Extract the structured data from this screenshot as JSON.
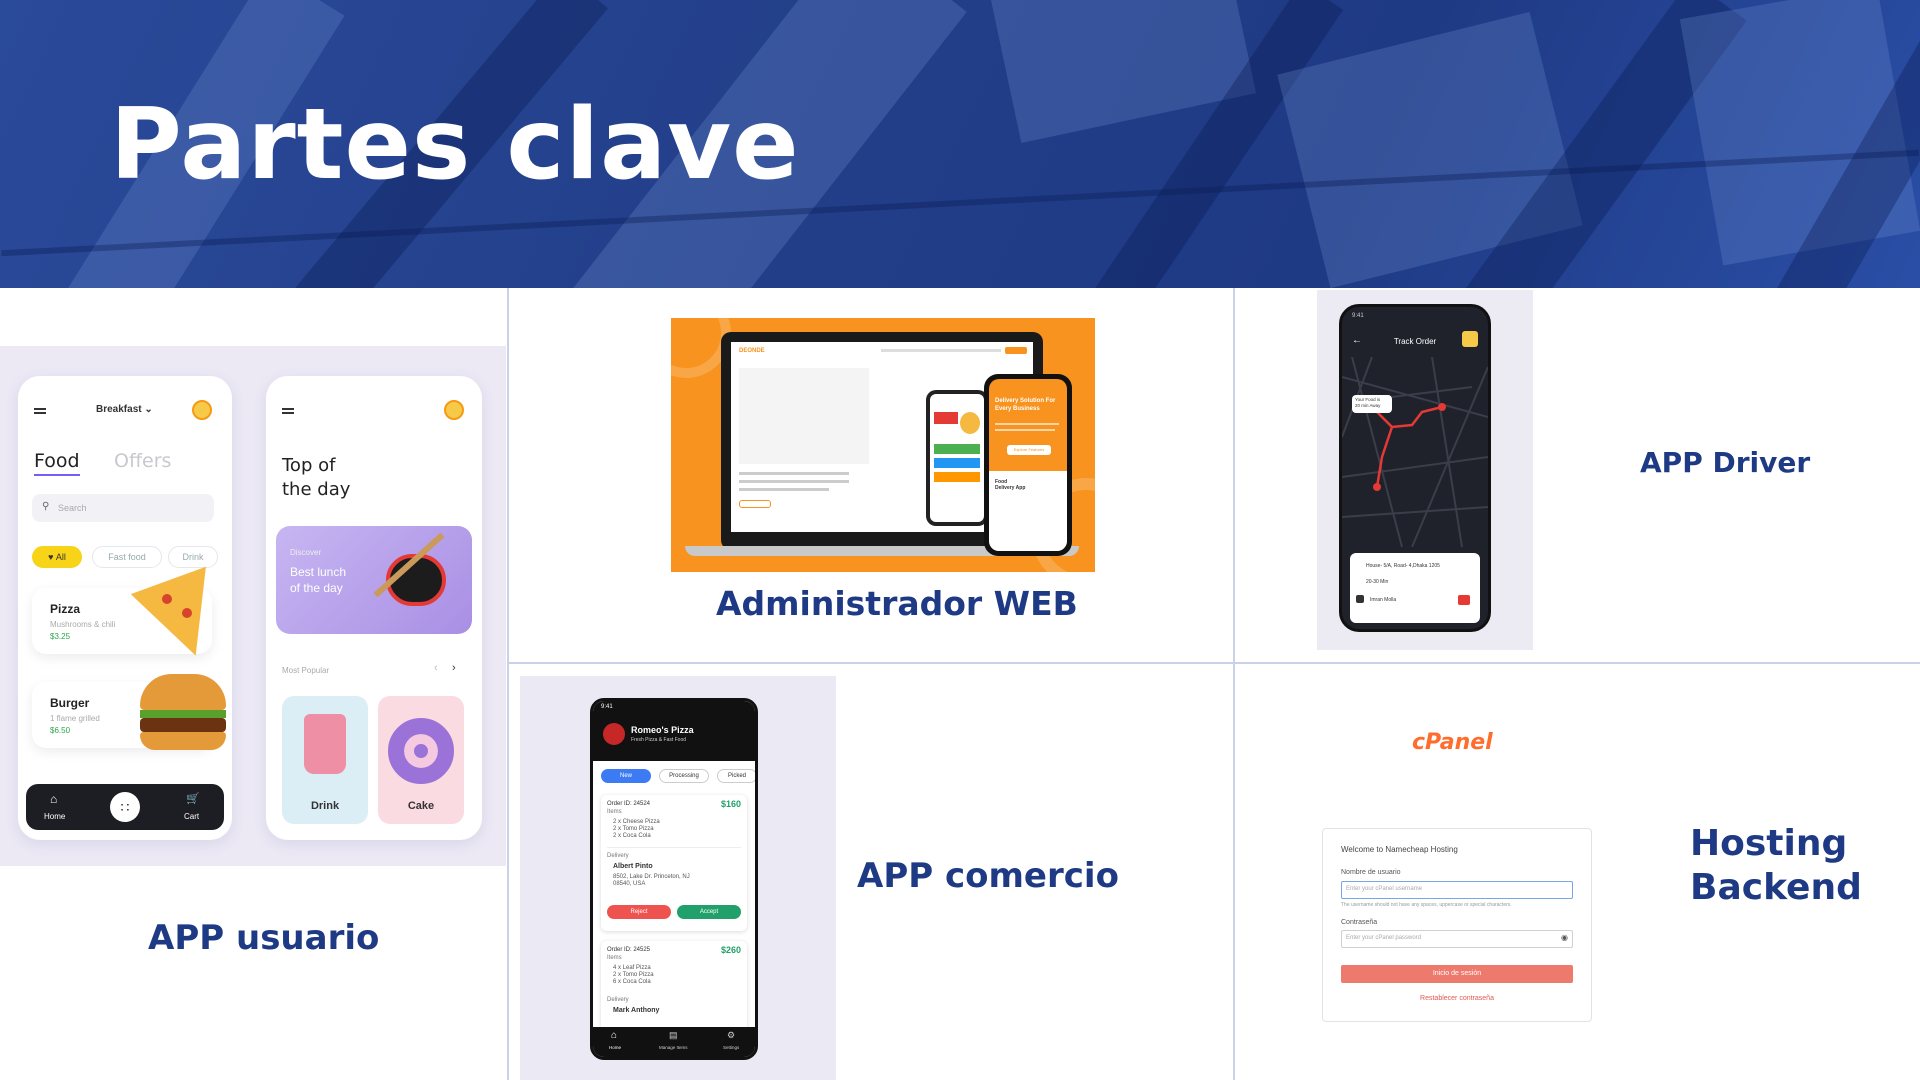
{
  "header": {
    "title": "Partes clave"
  },
  "sections": {
    "app_usuario": {
      "label": "APP usuario"
    },
    "admin_web": {
      "label": "Administrador WEB"
    },
    "app_driver": {
      "label": "APP Driver"
    },
    "app_comercio": {
      "label": "APP comercio"
    },
    "hosting": {
      "label_line1": "Hosting",
      "label_line2": "Backend"
    }
  },
  "user_app": {
    "category": "Breakfast",
    "tab_food": "Food",
    "tab_offers": "Offers",
    "search_placeholder": "Search",
    "chip_all": "All",
    "chip_fast": "Fast food",
    "chip_drink": "Drink",
    "items": [
      {
        "name": "Pizza",
        "desc": "Mushrooms & chili",
        "price": "$3.25"
      },
      {
        "name": "Burger",
        "desc": "1 flame grilled",
        "price": "$6.50"
      }
    ],
    "nav_home": "Home",
    "nav_cart": "Cart",
    "top_title_1": "Top of",
    "top_title_2": "the day",
    "promo_discover": "Discover",
    "promo_line1": "Best lunch",
    "promo_line2": "of the day",
    "most_popular": "Most Popular",
    "popular": [
      "Drink",
      "Cake"
    ]
  },
  "driver_app": {
    "time": "9:41",
    "title": "Track Order",
    "bubble_1": "Your Food is",
    "bubble_2": "20 min Away",
    "address": "House- 5/A, Road- 4,Dhaka 1205",
    "eta": "20-30 Min",
    "driver": "Imran Molla"
  },
  "commerce_app": {
    "time": "9:41",
    "store": "Romeo's Pizza",
    "store_sub": "Fresh Pizza & Fast Food",
    "tabs": [
      "New",
      "Processing",
      "Picked"
    ],
    "orders": [
      {
        "id": "Order ID: 24524",
        "amount": "$160",
        "items": [
          "2 x Cheese Pizza",
          "2 x Tomo Pizza",
          "2 x Coca Cola"
        ],
        "customer": "Albert Pinto",
        "address": "8502, Lake Dr. Princeton, NJ",
        "zip": "08540, USA"
      },
      {
        "id": "Order ID: 24525",
        "amount": "$260",
        "items": [
          "4 x Leaf Pizza",
          "2 x Tomo Pizza",
          "6 x Coca Cola"
        ],
        "customer": "Mark Anthony"
      }
    ],
    "items_label": "Items",
    "delivery_label": "Delivery",
    "reject": "Reject",
    "accept": "Accept",
    "nav": [
      "Home",
      "Manage Items",
      "Settings"
    ]
  },
  "cpanel": {
    "logo": "cPanel",
    "welcome": "Welcome to Namecheap Hosting",
    "user_label": "Nombre de usuario",
    "user_placeholder": "Enter your cPanel username",
    "user_hint": "The username should not have any spaces, uppercase or special characters.",
    "pass_label": "Contraseña",
    "pass_placeholder": "Enter your cPanel password",
    "login_button": "Inicio de sesión",
    "reset_link": "Restablecer contraseña"
  },
  "admin_site": {
    "brand": "DEONDE",
    "hero_1": "Delivery Solution For",
    "hero_2": "Every Business",
    "cta": "Explore Features",
    "food_app": "Food",
    "food_app_2": "Delivery App"
  },
  "colors": {
    "brand_navy": "#1f3a84",
    "orange": "#f7931e",
    "accept_green": "#22a06b",
    "reject_red": "#ef5350",
    "cpanel_orange": "#ff6c2c",
    "promo_purple": "#b8a6e6",
    "chip_yellow": "#f7d417"
  }
}
